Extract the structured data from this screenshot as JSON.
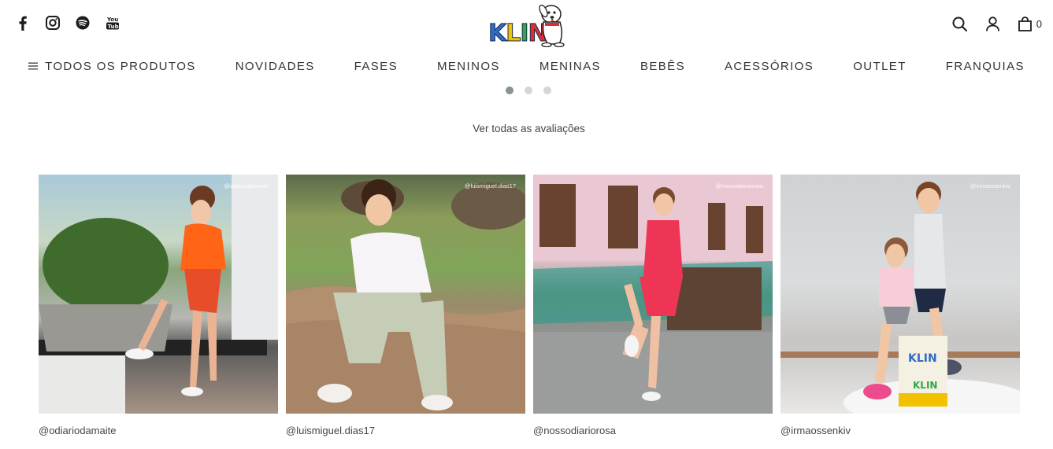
{
  "header": {
    "social": [
      "facebook-icon",
      "instagram-icon",
      "spotify-icon",
      "youtube-icon"
    ],
    "logo_text": "KLIN",
    "cart_count": "0"
  },
  "nav": {
    "items": [
      "TODOS OS PRODUTOS",
      "NOVIDADES",
      "FASES",
      "MENINOS",
      "MENINAS",
      "BEBÊS",
      "ACESSÓRIOS",
      "OUTLET",
      "FRANQUIAS"
    ]
  },
  "carousel": {
    "dots": 3,
    "active": 0
  },
  "reviews": {
    "see_all": "Ver todas as avaliações"
  },
  "gallery": [
    {
      "handle": "@odiariodamaite",
      "overlay": "@odiariodamaite"
    },
    {
      "handle": "@luismiguel.dias17",
      "overlay": "@luismiguel.dias17"
    },
    {
      "handle": "@nossodiariorosa",
      "overlay": "@nossodiariorosa"
    },
    {
      "handle": "@irmaossenkiv",
      "overlay": "@irmaossenkiv"
    }
  ],
  "colors": {
    "text": "#333333",
    "dot_active": "#8a9493",
    "dot": "#d6d6d6"
  }
}
